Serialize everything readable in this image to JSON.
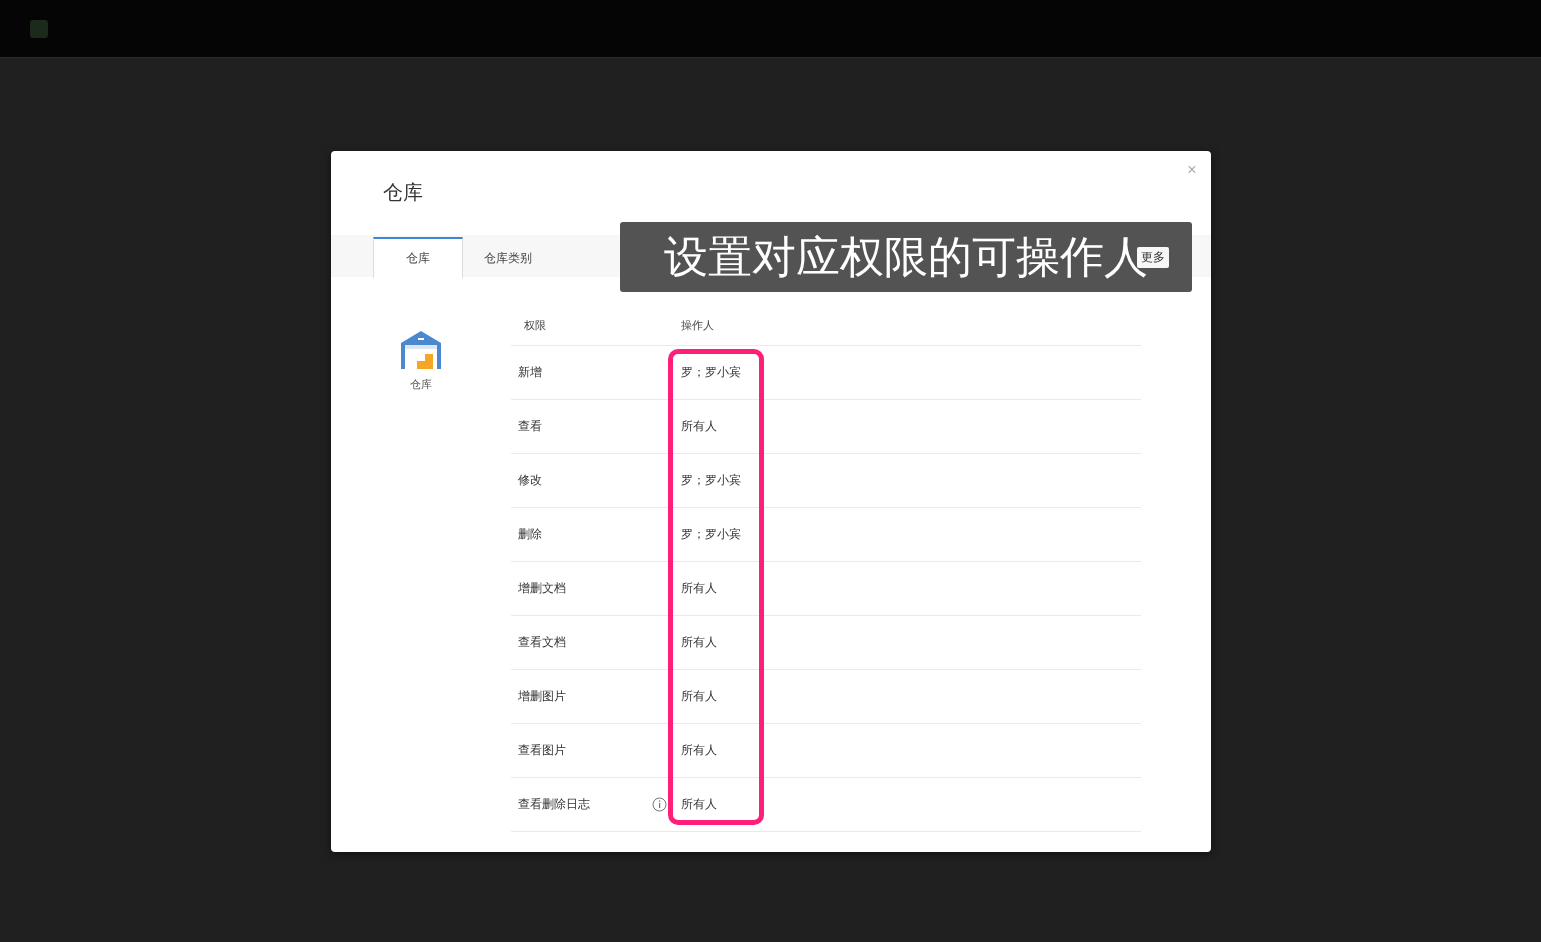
{
  "dialog": {
    "title": "仓库",
    "close": "×"
  },
  "tabs": [
    {
      "label": "仓库",
      "selected": true
    },
    {
      "label": "仓库类别",
      "selected": false
    }
  ],
  "more": "更多",
  "caption": "设置对应权限的可操作人",
  "sidebar": {
    "label": "仓库"
  },
  "table": {
    "columns": [
      "权限",
      "操作人"
    ],
    "rows": [
      {
        "permission": "新增",
        "operators": "罗；罗小宾",
        "info": false
      },
      {
        "permission": "查看",
        "operators": "所有人",
        "info": false
      },
      {
        "permission": "修改",
        "operators": "罗；罗小宾",
        "info": false
      },
      {
        "permission": "删除",
        "operators": "罗；罗小宾",
        "info": false
      },
      {
        "permission": "增删文档",
        "operators": "所有人",
        "info": false
      },
      {
        "permission": "查看文档",
        "operators": "所有人",
        "info": false
      },
      {
        "permission": "增删图片",
        "operators": "所有人",
        "info": false
      },
      {
        "permission": "查看图片",
        "operators": "所有人",
        "info": false
      },
      {
        "permission": "查看删除日志",
        "operators": "所有人",
        "info": true
      }
    ]
  }
}
